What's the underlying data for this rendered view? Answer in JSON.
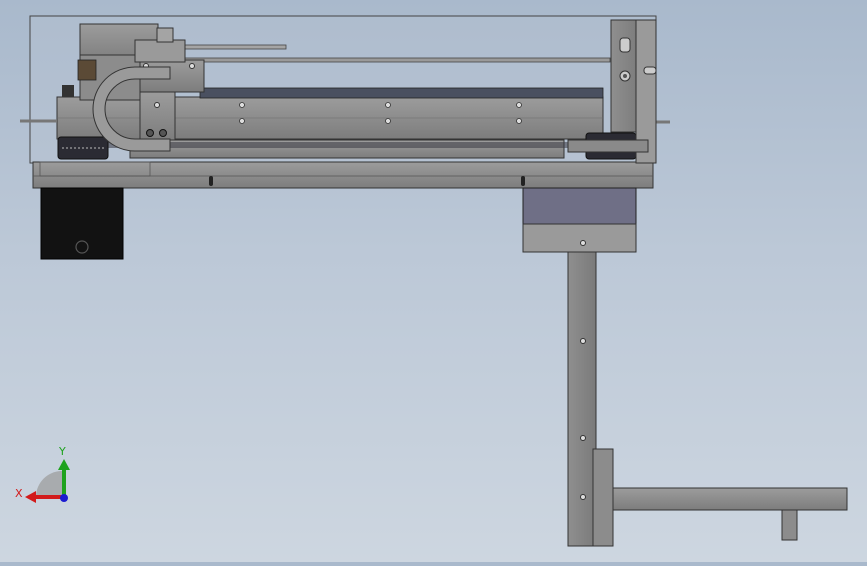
{
  "viewport": {
    "background_top": "#a9b9cc",
    "background_bottom": "#cdd6e0"
  },
  "triad": {
    "x_label": "X",
    "y_label": "Y",
    "x_color": "#d21a1a",
    "y_color": "#1ea21e",
    "z_color": "#1b1bd0"
  },
  "model": {
    "part_gray": "#8a8a8a",
    "part_light": "#a9a9a9",
    "motor_black": "#121212",
    "motor_purple": "#6f6f86",
    "belt_dark": "#2b2b33"
  }
}
